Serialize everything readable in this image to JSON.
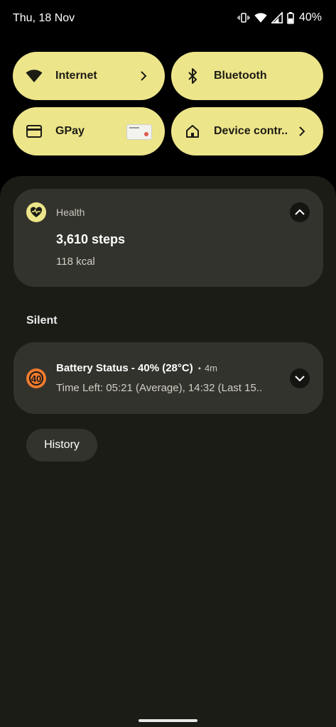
{
  "status_bar": {
    "date": "Thu, 18 Nov",
    "battery_percent": "40%",
    "icons": [
      "vibrate-icon",
      "wifi-icon",
      "signal-icon",
      "battery-icon"
    ]
  },
  "quick_tiles": [
    {
      "label": "Internet",
      "icon": "wifi-icon",
      "has_chevron": true
    },
    {
      "label": "Bluetooth",
      "icon": "bluetooth-icon",
      "has_chevron": false
    },
    {
      "label": "GPay",
      "icon": "card-icon",
      "has_chevron": false
    },
    {
      "label": "Device contr..",
      "icon": "home-icon",
      "has_chevron": true
    }
  ],
  "notifications": {
    "health": {
      "app": "Health",
      "title": "3,610 steps",
      "text": "118 kcal"
    },
    "section_label": "Silent",
    "battery": {
      "icon_text": "40",
      "title": "Battery Status - 40% (28°C)",
      "separator": "•",
      "time": "4m",
      "text": "Time Left: 05:21 (Average), 14:32 (Last 15.."
    },
    "history_label": "History"
  },
  "colors": {
    "tile": "#ede58a",
    "shade": "#1c1c17",
    "card": "#33332d",
    "battery_icon": "#f07b2e"
  }
}
